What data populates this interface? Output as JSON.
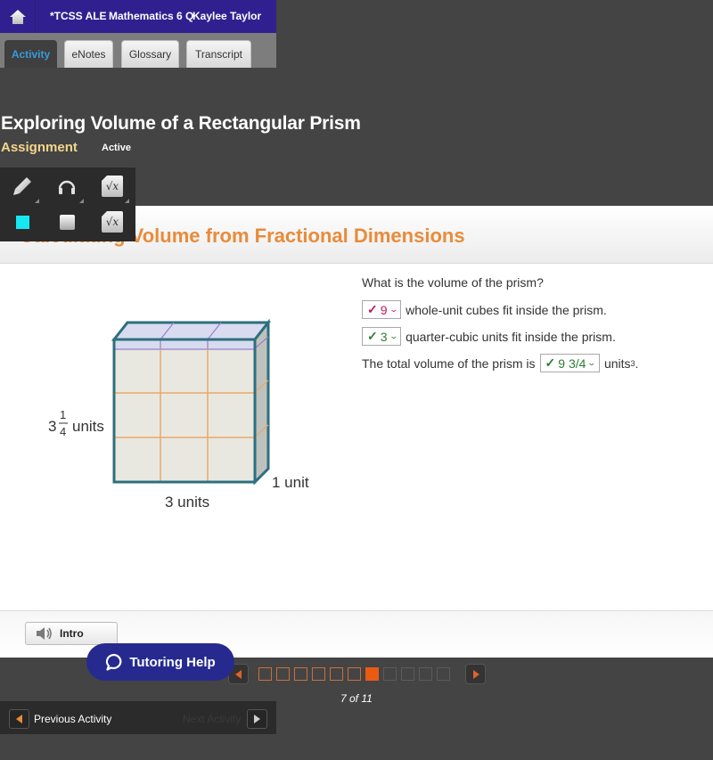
{
  "topbar": {
    "title_fragments": [
      "*TCSS ALE",
      "Mathematics 6 Q",
      "Kaylee Taylor"
    ],
    "title_overlap": [
      "*TCSS ALEMgthematics 6 QKaylee Taylor"
    ],
    "home_icon": "home-icon",
    "color": "#30208f"
  },
  "tabs": [
    {
      "label": "Activity",
      "active": true
    },
    {
      "label": "eNotes",
      "active": false
    },
    {
      "label": "Glossary",
      "active": false
    },
    {
      "label": "Transcript",
      "active": false
    }
  ],
  "activity": {
    "title": "Exploring Volume of a Rectangular Prism",
    "type_label": "Assignment",
    "status": "Active"
  },
  "tools": [
    {
      "name": "pencil-icon"
    },
    {
      "name": "headphones-icon"
    },
    {
      "name": "math-formula-icon",
      "glyph": "√x"
    },
    {
      "name": "highlight-color-icon",
      "color": "#16e8f2"
    },
    {
      "name": "eraser-square-icon"
    },
    {
      "name": "math-formula-icon",
      "glyph": "√x"
    }
  ],
  "section": {
    "title": "Calculating Volume from Fractional Dimensions",
    "color": "#e98b3a"
  },
  "figure": {
    "height_label_whole": "3",
    "height_label_num": "1",
    "height_label_den": "4",
    "height_label_unit": "units",
    "width_label": "3 units",
    "depth_label": "1 unit"
  },
  "question": {
    "prompt": "What is the volume of the prism?",
    "line1": {
      "check": "✓",
      "value": "9",
      "text": "whole-unit cubes fit inside the prism.",
      "color": "#c2185b"
    },
    "line2": {
      "check": "✓",
      "value": "3",
      "text": "quarter-cubic units fit inside the prism.",
      "color": "#2e7d32"
    },
    "line3": {
      "prefix": "The total volume of the prism is",
      "check": "✓",
      "value": "9 3/4",
      "suffix": "units",
      "sup": "3",
      "end": ".",
      "color": "#2e7d32"
    }
  },
  "intro": {
    "label": "Intro"
  },
  "tutoring": {
    "label": "Tutoring Help"
  },
  "pager": {
    "current": 7,
    "total": 11,
    "label": "7 of 11"
  },
  "activity_nav": {
    "prev_label": "Previous Activity",
    "next_label": "Next Activity"
  }
}
